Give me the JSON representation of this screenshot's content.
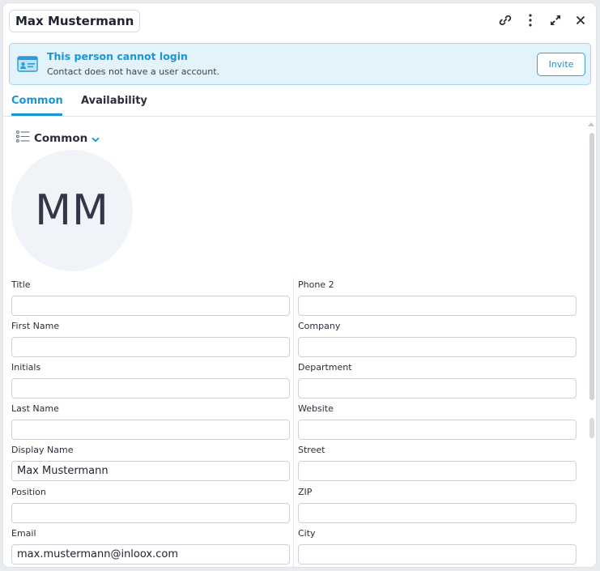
{
  "header": {
    "title": "Max Mustermann"
  },
  "banner": {
    "title": "This person cannot login",
    "subtitle": "Contact does not have a user account.",
    "invite_label": "Invite"
  },
  "tabs": [
    {
      "label": "Common",
      "active": true
    },
    {
      "label": "Availability",
      "active": false
    }
  ],
  "section": {
    "title": "Common",
    "avatar_initials": "MM"
  },
  "form": {
    "left": [
      {
        "label": "Title",
        "value": ""
      },
      {
        "label": "First Name",
        "value": ""
      },
      {
        "label": "Initials",
        "value": ""
      },
      {
        "label": "Last Name",
        "value": ""
      },
      {
        "label": "Display Name",
        "value": "Max Mustermann"
      },
      {
        "label": "Position",
        "value": ""
      },
      {
        "label": "Email",
        "value": "max.mustermann@inloox.com"
      }
    ],
    "right": [
      {
        "label": "Phone 2",
        "value": ""
      },
      {
        "label": "Company",
        "value": ""
      },
      {
        "label": "Department",
        "value": ""
      },
      {
        "label": "Website",
        "value": ""
      },
      {
        "label": "Street",
        "value": ""
      },
      {
        "label": "ZIP",
        "value": ""
      },
      {
        "label": "City",
        "value": ""
      }
    ]
  },
  "colors": {
    "accent": "#1a95d8",
    "banner_bg": "#e3f3fb",
    "border": "#ccd1d8"
  }
}
